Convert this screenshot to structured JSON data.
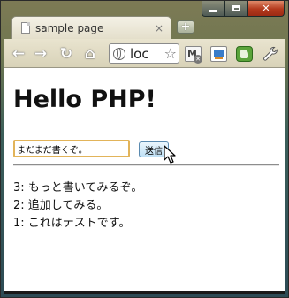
{
  "window": {
    "controls": [
      "minimize-icon",
      "maximize-icon",
      "close-icon"
    ],
    "close_glyph": "✕"
  },
  "tab": {
    "title": "sample page",
    "close_glyph": "×",
    "icon": "page-icon"
  },
  "new_tab_glyph": "+",
  "toolbar": {
    "back_glyph": "←",
    "forward_glyph": "→",
    "reload_glyph": "↻",
    "home_glyph": "⌂",
    "address_text": "loc",
    "star_glyph": "☆",
    "mail_glyph": "M",
    "mail_badge_glyph": "✕"
  },
  "page": {
    "heading": "Hello PHP!",
    "input_value": "まだまだ書くぞ。",
    "submit_label": "送信",
    "messages": [
      "3: もっと書いてみるぞ。",
      "2: 追加してみる。",
      "1: これはテストです。"
    ]
  },
  "colors": {
    "input_focus_border": "#e2b45a",
    "button_bg": "#bfe0f5",
    "close_button": "#b3391c",
    "frame": "#3c5f5a"
  }
}
